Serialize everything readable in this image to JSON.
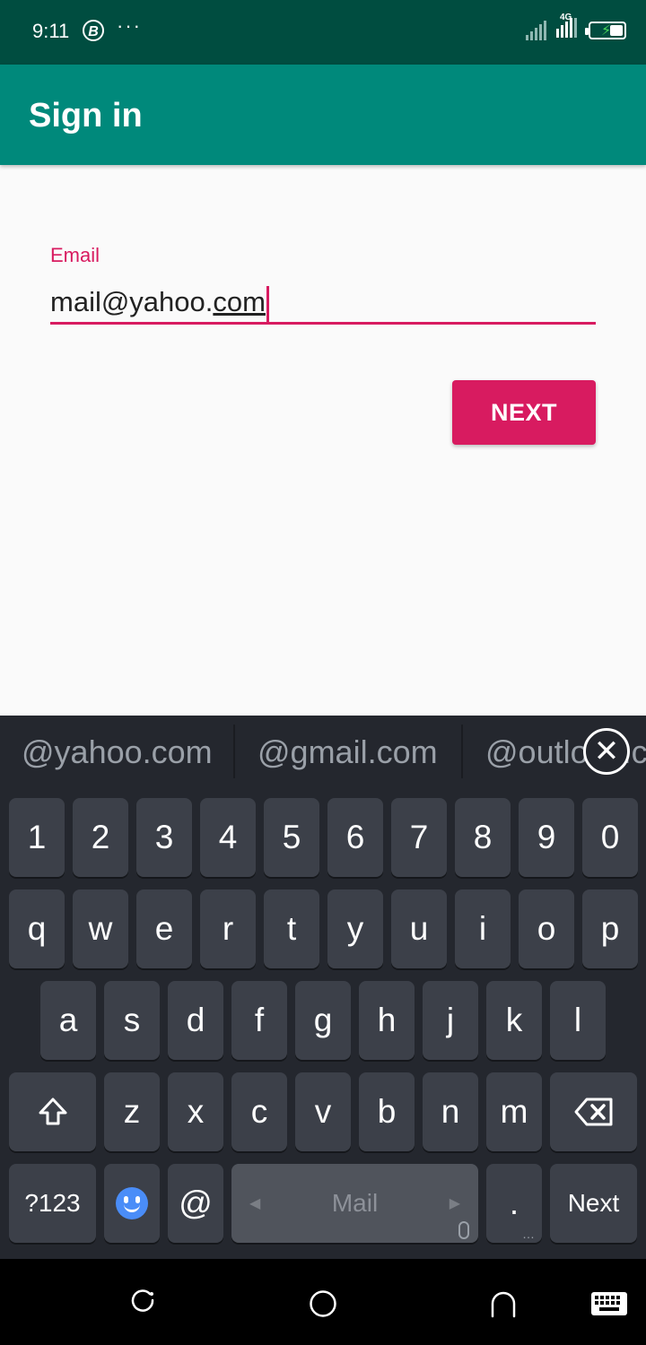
{
  "status_bar": {
    "time": "9:11",
    "badge": "B",
    "more": "···",
    "network": "4G"
  },
  "app_bar": {
    "title": "Sign in"
  },
  "form": {
    "email_label": "Email",
    "email_value_prefix": "mail@yahoo.",
    "email_value_suffix": "com",
    "next_label": "NEXT"
  },
  "keyboard": {
    "suggestions": [
      "@yahoo.com",
      "@gmail.com",
      "@outlook.com"
    ],
    "close_symbol": "✕",
    "row1": [
      "1",
      "2",
      "3",
      "4",
      "5",
      "6",
      "7",
      "8",
      "9",
      "0"
    ],
    "row2": [
      "q",
      "w",
      "e",
      "r",
      "t",
      "y",
      "u",
      "i",
      "o",
      "p"
    ],
    "row3": [
      "a",
      "s",
      "d",
      "f",
      "g",
      "h",
      "j",
      "k",
      "l"
    ],
    "row4": [
      "z",
      "x",
      "c",
      "v",
      "b",
      "n",
      "m"
    ],
    "symbols_label": "?123",
    "at_label": "@",
    "space_label": "Mail",
    "period_label": ".",
    "action_label": "Next"
  },
  "icons": {
    "shift": "shift-icon",
    "backspace": "backspace-icon",
    "emoji": "emoji-icon",
    "mic": "mic-icon",
    "recent": "recent-apps-icon",
    "home": "home-icon",
    "back": "back-icon",
    "keyboard": "keyboard-icon"
  },
  "colors": {
    "primary": "#00897b",
    "primary_dark": "#004d40",
    "accent": "#d81b60"
  }
}
